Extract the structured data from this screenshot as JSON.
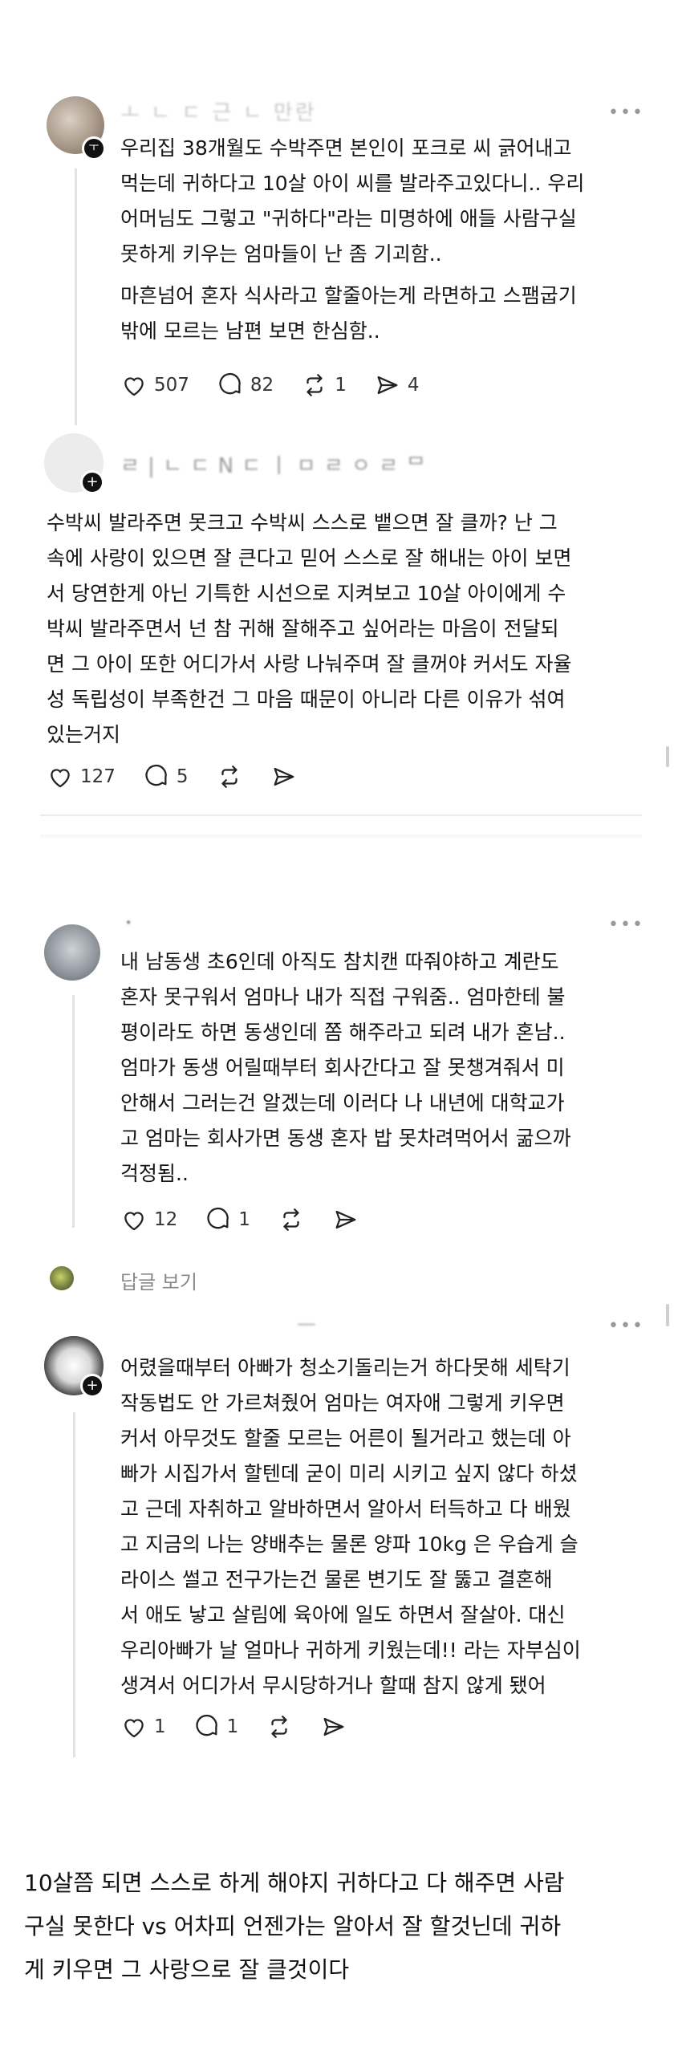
{
  "posts": [
    {
      "username": "ㅗ ㄴ ㄷ 근 ㄴ 만란",
      "more": "•••",
      "paragraphs": [
        "우리집 38개월도 수박주면 본인이 포크로 씨 긁어내고\n먹는데 귀하다고 10살 아이 씨를 발라주고있다니.. 우리\n어머님도 그렇고 \"귀하다\"라는 미명하에 애들 사람구실\n못하게 키우는 엄마들이 난 좀 기괴함..",
        "마흔넘어 혼자 식사라고 할줄아는게 라면하고 스팸굽기\n밖에 모르는 남편 보면 한심함.."
      ],
      "likes": "507",
      "comments": "82",
      "reposts": "1",
      "shares": "4"
    },
    {
      "username": "ㄹ | ㄴ ㄷ N ㄷ ㅣ ㅁ ㄹ ㅇ ㄹ ᄆ",
      "paragraphs": [
        "수박씨 발라주면 못크고 수박씨 스스로 뱉으면 잘 클까? 난 그\n속에 사랑이 있으면 잘 큰다고 믿어 스스로 잘 해내는 아이 보면\n서 당연한게 아닌 기특한 시선으로 지켜보고 10살 아이에게 수\n박씨 발라주면서 넌 참 귀해 잘해주고 싶어라는 마음이 전달되\n면 그 아이 또한 어디가서 사랑 나눠주며 잘 클꺼야 커서도 자율\n성 독립성이 부족한건 그  마음 때문이 아니라 다른 이유가 섞여\n있는거지"
      ],
      "likes": "127",
      "comments": "5"
    },
    {
      "username": "ㆍ",
      "more": "•••",
      "paragraphs": [
        "내 남동생 초6인데 아직도 참치캔 따줘야하고 계란도\n혼자 못구워서 엄마나 내가 직접 구워줌.. 엄마한테 불\n평이라도 하면 동생인데 쫌 해주라고 되려 내가 혼남..\n엄마가 동생 어릴때부터 회사간다고 잘 못챙겨줘서 미\n안해서 그러는건 알겠는데 이러다 나 내년에 대학교가\n고 엄마는 회사가면 동생 혼자 밥 못차려먹어서 굶으까\n걱정됨.."
      ],
      "likes": "12",
      "comments": "1",
      "view_replies": "답글 보기"
    },
    {
      "username": "ㅡ",
      "more": "•••",
      "paragraphs": [
        "어렸을때부터 아빠가  청소기돌리는거 하다못해 세탁기\n작동법도 안 가르쳐줬어  엄마는 여자애 그렇게 키우면\n커서 아무것도 할줄 모르는 어른이 될거라고 했는데 아\n빠가 시집가서 할텐데 굳이 미리 시키고 싶지 않다 하셨\n고 근데  자취하고 알바하면서 알아서 터득하고 다 배웠\n고 지금의 나는 양배추는 물론 양파 10kg 은 우습게 슬\n라이스 썰고  전구가는건 물론 변기도 잘 뚫고  결혼해\n서 애도 낳고 살림에 육아에 일도 하면서 잘살아.  대신\n우리아빠가 날 얼마나 귀하게 키웠는데!! 라는 자부심이\n생겨서 어디가서 무시당하거나 할때 참지 않게 됐어"
      ],
      "likes": "1",
      "comments": "1"
    }
  ],
  "caption": "10살쯤 되면 스스로 하게 해야지 귀하다고 다 해주면 사람\n구실 못한다 vs 어차피 언젠가는 알아서 잘 할것닌데 귀하\n게 키우면 그 사랑으로 잘 클것이다",
  "icons": {
    "like": "heart-icon",
    "comment": "comment-bubble-icon",
    "repost": "repost-icon",
    "share": "share-icon"
  },
  "colors": {
    "text": "#151515",
    "muted": "#888888",
    "divider": "#ececec"
  }
}
